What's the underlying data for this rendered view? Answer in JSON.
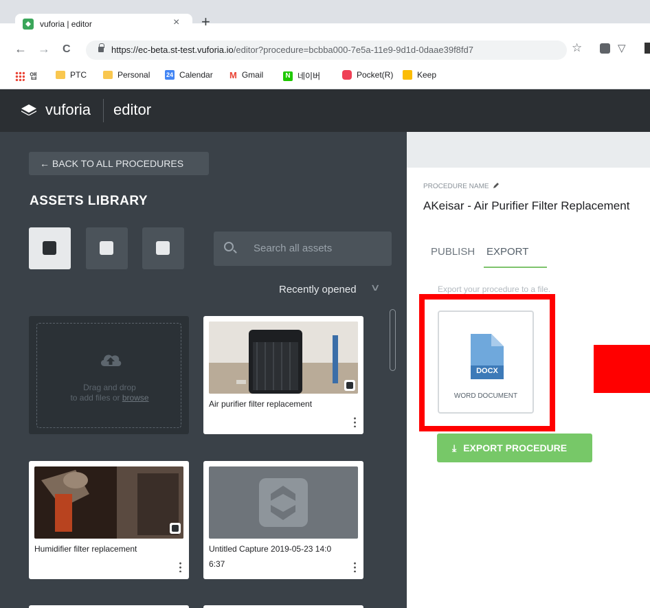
{
  "browser": {
    "tab_title": "vuforia | editor",
    "tab_close": "×",
    "new_tab": "+",
    "nav": {
      "back": "←",
      "forward": "→",
      "reload": "C"
    },
    "url_host": "https://ec-beta.st-test.vuforia.io",
    "url_path": "/editor?procedure=bcbba000-7e5a-11e9-9d1d-0daae39f8fd7",
    "star": "☆",
    "ext_pocket": "▽",
    "bookmarks": [
      {
        "label": "앱"
      },
      {
        "label": "PTC"
      },
      {
        "label": "Personal"
      },
      {
        "label": "Calendar",
        "icon_text": "24"
      },
      {
        "label": "Gmail",
        "icon_text": "M"
      },
      {
        "label": "네이버",
        "icon_text": "N"
      },
      {
        "label": "Pocket(R)"
      },
      {
        "label": "Keep"
      }
    ]
  },
  "app": {
    "brand": "vuforia",
    "product": "editor"
  },
  "left": {
    "back_label": "← BACK TO ALL PROCEDURES",
    "title": "ASSETS LIBRARY",
    "search_placeholder": "Search all assets",
    "sort_label": "Recently opened",
    "sort_chevron": "∨",
    "dropzone_line1": "Drag and drop",
    "dropzone_line2_prefix": "to add files or ",
    "dropzone_link": "browse",
    "cards": [
      {
        "label": "Air purifier filter replacement",
        "label2": ""
      },
      {
        "label": "Humidifier filter replacement",
        "label2": ""
      },
      {
        "label": "Untitled Capture 2019-05-23 14:0",
        "label2": "6:37"
      }
    ]
  },
  "right": {
    "proc_label": "PROCEDURE NAME",
    "proc_name": "AKeisar - Air Purifier Filter Replacement",
    "tabs": {
      "publish": "PUBLISH",
      "export": "EXPORT"
    },
    "description": "Export your procedure to a file.",
    "docx_badge": "DOCX",
    "docx_caption": "WORD DOCUMENT",
    "export_button": "EXPORT PROCEDURE",
    "export_icon": "⤓"
  },
  "colors": {
    "appbar": "#2b2f33",
    "panel": "#3a4148",
    "accent_green": "#77c868",
    "annotation_red": "#ff0000",
    "docx_blue": "#6fa8dc"
  },
  "icons": {
    "filters": [
      "download-asset-icon",
      "image-icon",
      "video-icon"
    ],
    "upload": "cloud-upload-icon",
    "docx": "docx-file-icon"
  }
}
